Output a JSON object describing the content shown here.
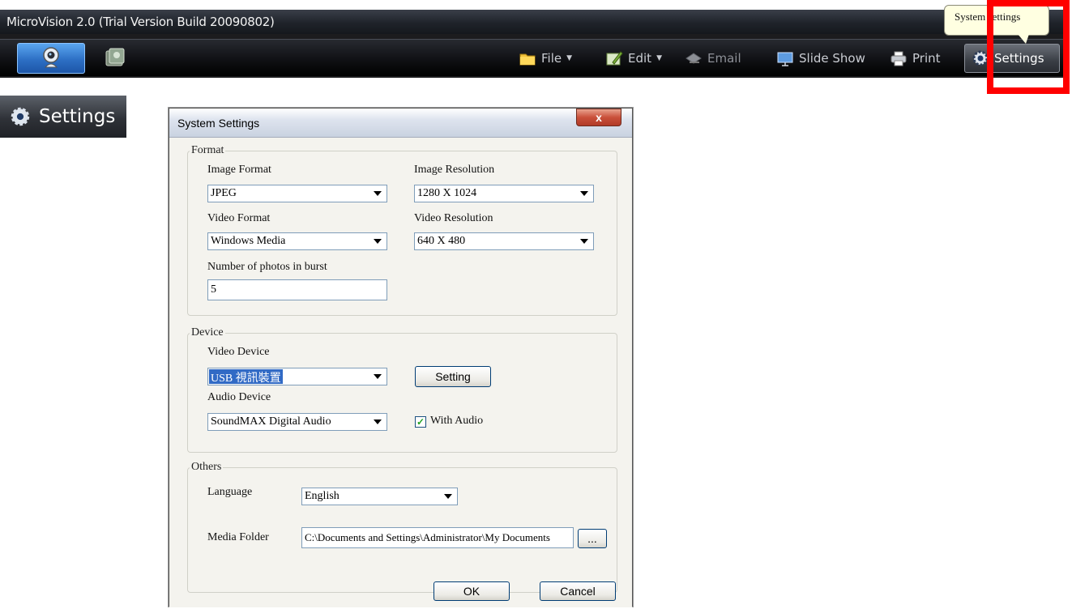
{
  "app": {
    "title": "MicroVision 2.0 (Trial Version Build 20090802)",
    "toolbar": {
      "file_label": "File",
      "edit_label": "Edit",
      "email_label": "Email",
      "slideshow_label": "Slide Show",
      "print_label": "Print",
      "settings_label": "Settings"
    },
    "tooltip": "System settings"
  },
  "zoom": {
    "settings_label": "Settings"
  },
  "dialog": {
    "title": "System Settings",
    "close_label": "x",
    "format": {
      "legend": "Format",
      "image_format_label": "Image Format",
      "image_format_value": "JPEG",
      "image_resolution_label": "Image Resolution",
      "image_resolution_value": "1280 X 1024",
      "video_format_label": "Video Format",
      "video_format_value": "Windows Media",
      "video_resolution_label": "Video Resolution",
      "video_resolution_value": "640 X 480",
      "burst_label": "Number of photos in burst",
      "burst_value": "5"
    },
    "device": {
      "legend": "Device",
      "video_device_label": "Video Device",
      "video_device_value": "USB 視訊裝置",
      "setting_button": "Setting",
      "audio_device_label": "Audio Device",
      "audio_device_value": "SoundMAX Digital Audio",
      "with_audio_label": "With Audio",
      "with_audio_checked": true
    },
    "others": {
      "legend": "Others",
      "language_label": "Language",
      "language_value": "English",
      "media_folder_label": "Media Folder",
      "media_folder_value": "C:\\Documents and Settings\\Administrator\\My Documents",
      "browse_label": "..."
    },
    "ok_label": "OK",
    "cancel_label": "Cancel"
  },
  "colors": {
    "highlight": "#ff0000",
    "selection": "#316ac5",
    "tooltip": "#ffffe1"
  }
}
